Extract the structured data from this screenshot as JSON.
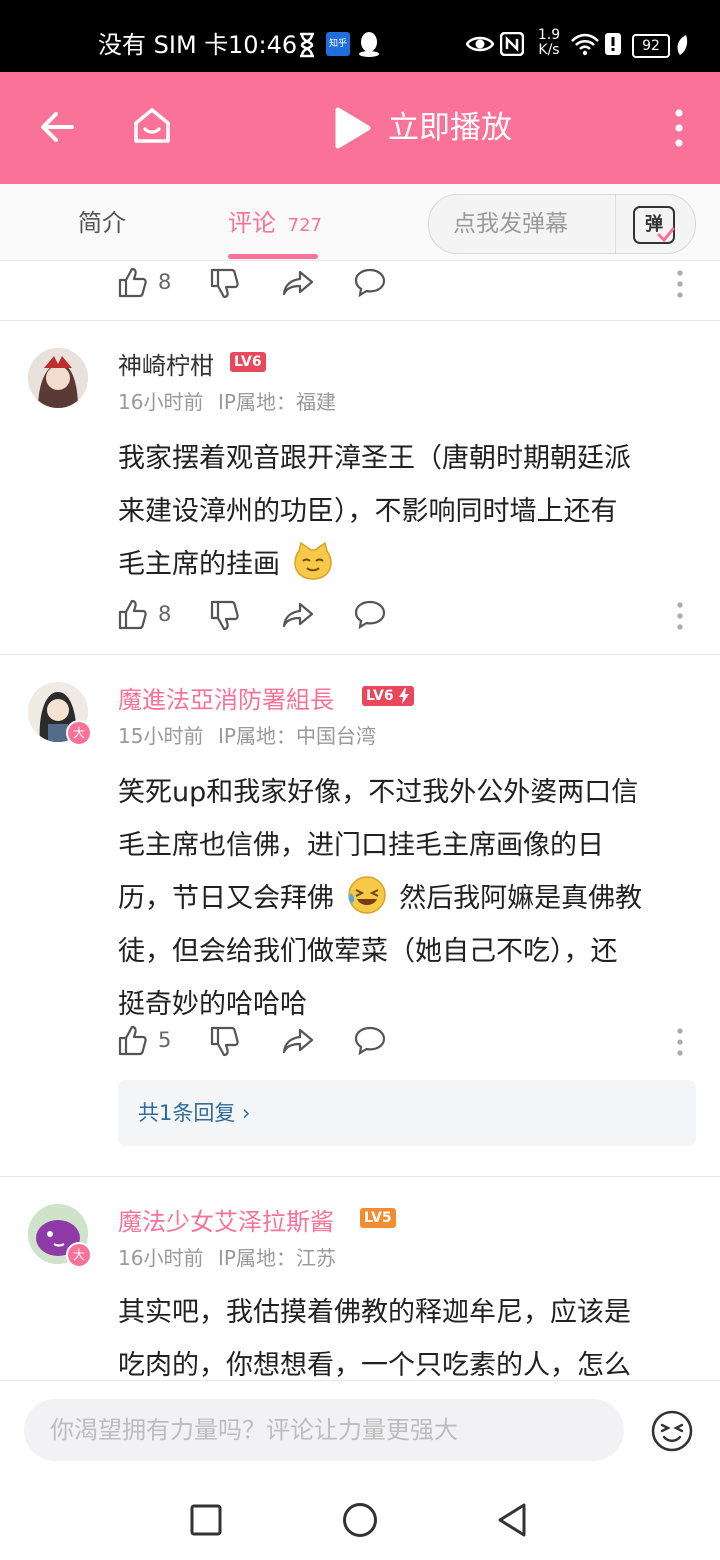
{
  "status_bar": {
    "left_text": "没有 SIM 卡",
    "time": "10:46",
    "zhihu_badge": "知乎",
    "network_speed_value": "1.9",
    "network_speed_unit": "K/s",
    "battery": "92"
  },
  "app_bar": {
    "play_label": "立即播放",
    "colors": {
      "brand": "#fb7299"
    }
  },
  "tabs": {
    "intro_label": "简介",
    "comments_label": "评论",
    "comments_count": "727",
    "danmaku_placeholder": "点我发弹幕",
    "danmaku_button": "弹"
  },
  "comments": [
    {
      "partial": true,
      "likes": "8"
    },
    {
      "username": "神崎柠柑",
      "level": "LV6",
      "time": "16小时前",
      "ip_label": "IP属地：福建",
      "text_lines": [
        "我家摆着观音跟开漳圣王（唐朝时期朝廷派",
        "来建设漳州的功臣），不影响同时墙上还有",
        "毛主席的挂画"
      ],
      "emoji": "cat-face-emoji",
      "likes": "8"
    },
    {
      "username": "魔進法亞消防署組長",
      "level": "LV6",
      "badge": "大",
      "time": "15小时前",
      "ip_label": "IP属地：中国台湾",
      "text_lines": [
        "笑死up和我家好像，不过我外公外婆两口信",
        "毛主席也信佛，进门口挂毛主席画像的日",
        "历，节日又会拜佛",
        "然后我阿嫲是真佛教",
        "徒，但会给我们做荤菜（她自己不吃），还",
        "挺奇妙的哈哈哈"
      ],
      "emoji": "laughing-crying-emoji",
      "likes": "5",
      "replies_label": "共1条回复 ›"
    },
    {
      "username": "魔法少女艾泽拉斯酱",
      "level": "LV5",
      "badge": "大",
      "time": "16小时前",
      "ip_label": "IP属地：江苏",
      "text_lines": [
        "其实吧，我估摸着佛教的释迦牟尼，应该是",
        "吃肉的，你想想看，一个只吃素的人，怎么"
      ]
    }
  ],
  "input": {
    "placeholder": "你渴望拥有力量吗？评论让力量更强大"
  },
  "colors": {
    "vip_name": "#fb7299",
    "lv6": "#e9475b",
    "lv5": "#f48c32",
    "reply_link": "#2f6b9a"
  }
}
